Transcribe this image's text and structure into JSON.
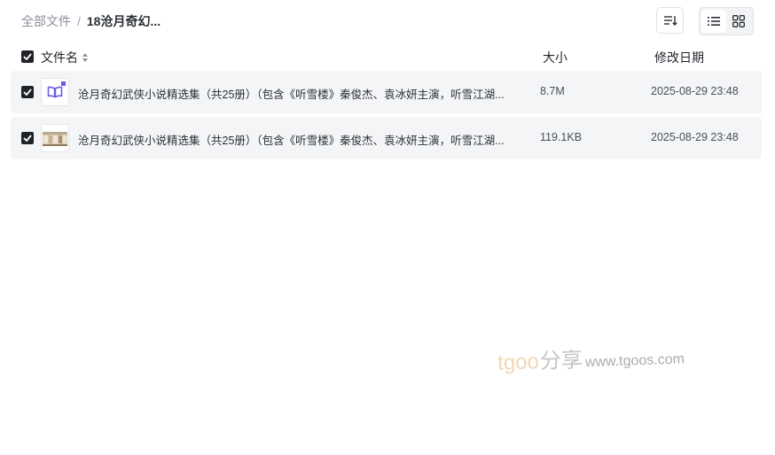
{
  "breadcrumb": {
    "root": "全部文件",
    "separator": "/",
    "current": "18沧月奇幻..."
  },
  "toolbar": {
    "sort_icon": "sort-icon",
    "list_view_icon": "list-view-icon",
    "grid_view_icon": "grid-view-icon",
    "active_view": "list"
  },
  "columns": {
    "name": "文件名",
    "size": "大小",
    "modified": "修改日期"
  },
  "files": [
    {
      "icon": "book-icon",
      "name": "沧月奇幻武侠小说精选集（共25册）（包含《听雪楼》秦俊杰、袁冰妍主演，听雪江湖...",
      "size": "8.7M",
      "modified": "2025-08-29 23:48",
      "checked": true
    },
    {
      "icon": "image-thumbnail",
      "name": "沧月奇幻武侠小说精选集（共25册）（包含《听雪楼》秦俊杰、袁冰妍主演，听雪江湖...",
      "size": "119.1KB",
      "modified": "2025-08-29 23:48",
      "checked": true
    }
  ],
  "watermark": {
    "brand": "tgoo",
    "share": "分享",
    "url": "www.tgoos.com"
  },
  "colors": {
    "row_background": "#f4f5f6",
    "checkbox": "#1f2329",
    "book_icon": "#6b5ce7",
    "watermark_brand": "#f2d7b4"
  }
}
